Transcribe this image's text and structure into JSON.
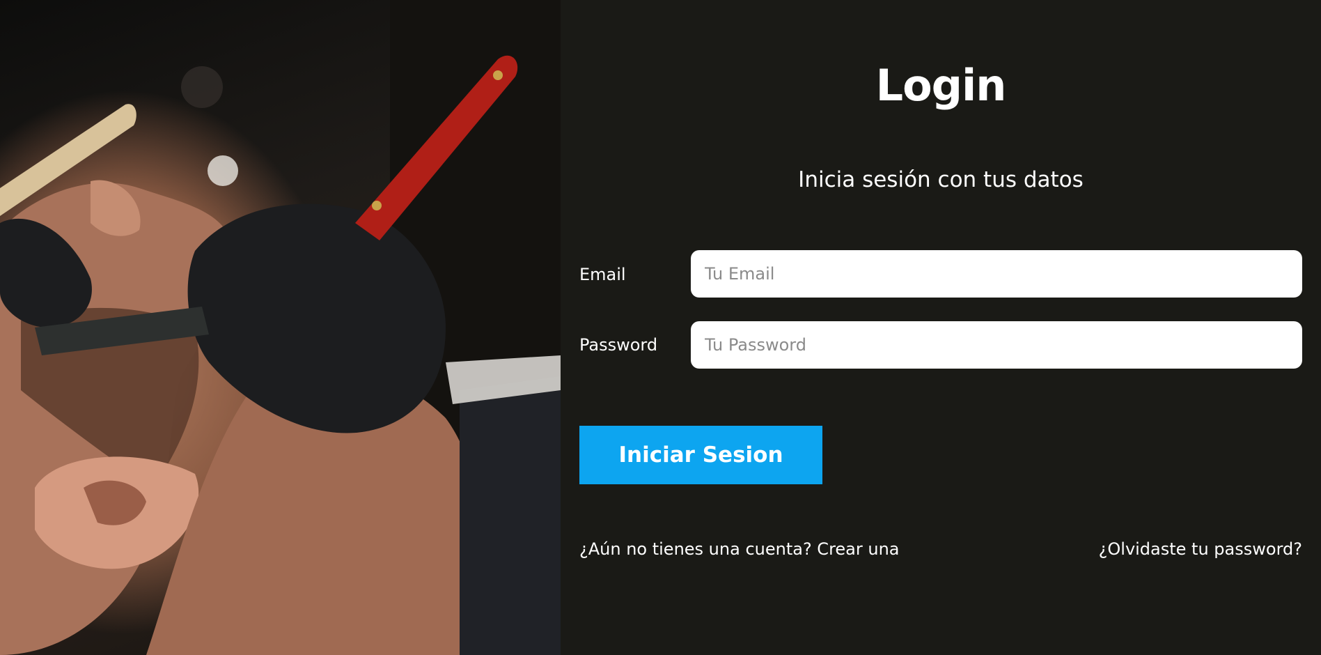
{
  "photo": {
    "alt": "barber-shaving-photo"
  },
  "login": {
    "title": "Login",
    "subtitle": "Inicia sesión con tus datos",
    "email": {
      "label": "Email",
      "placeholder": "Tu Email",
      "value": ""
    },
    "password": {
      "label": "Password",
      "placeholder": "Tu Password",
      "value": ""
    },
    "submit_label": "Iniciar Sesion",
    "create_account_link": "¿Aún no tienes una cuenta? Crear una",
    "forgot_password_link": "¿Olvidaste tu password?"
  },
  "colors": {
    "background": "#1a1a16",
    "button": "#0da5f0",
    "text": "#ffffff",
    "input_bg": "#ffffff"
  }
}
